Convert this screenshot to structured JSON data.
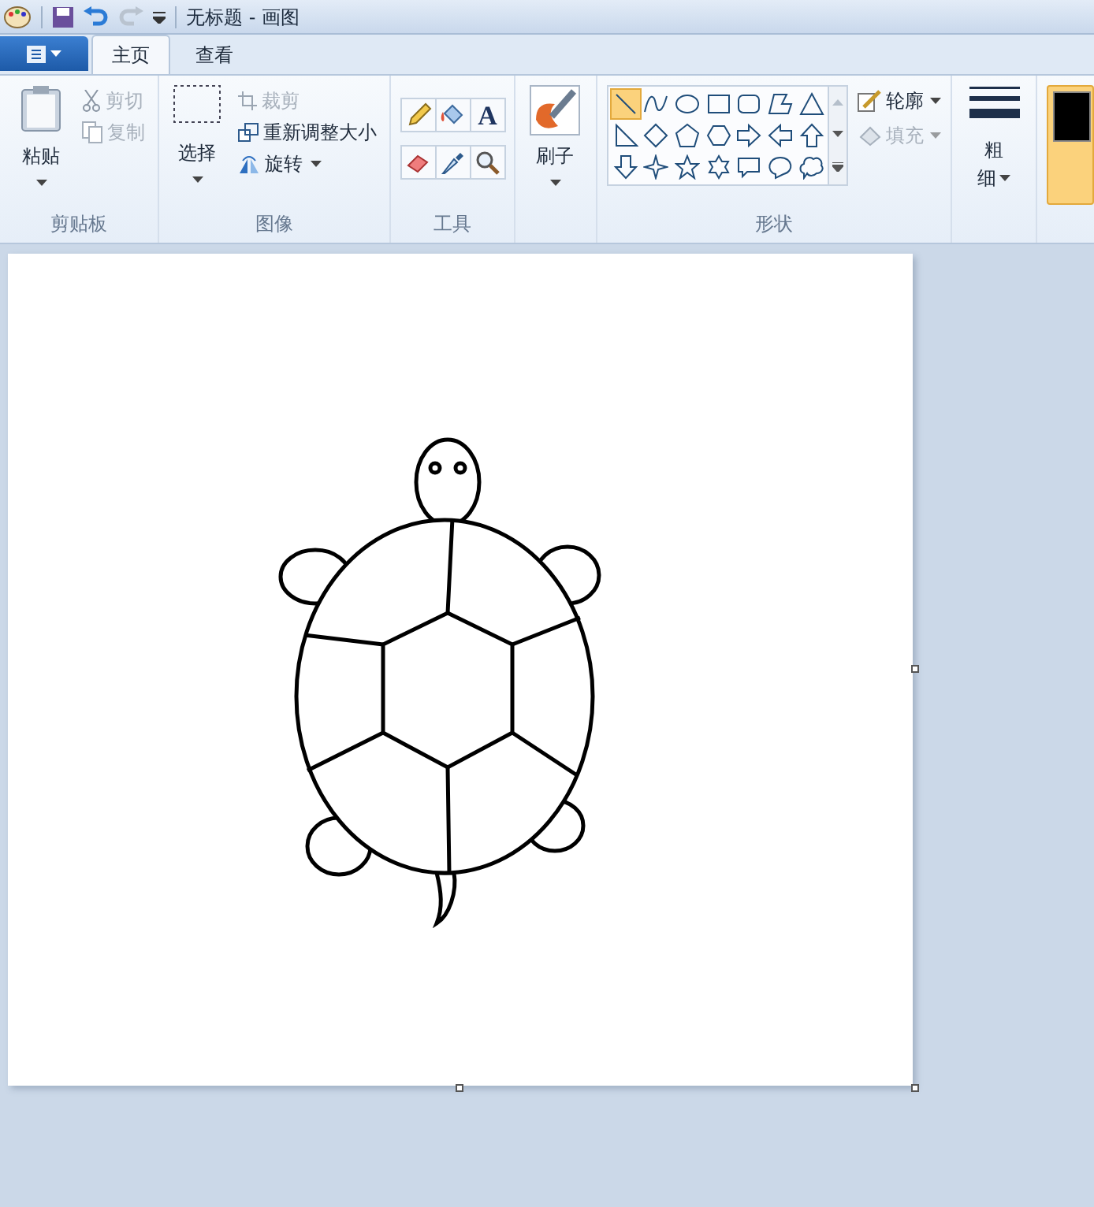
{
  "title_bar": {
    "title": "无标题 - 画图"
  },
  "tabs": [
    {
      "label": "主页",
      "selected": true
    },
    {
      "label": "查看",
      "selected": false
    }
  ],
  "ribbon": {
    "clipboard": {
      "paste": "粘贴",
      "cut": {
        "label": "剪切",
        "disabled": true
      },
      "copy": {
        "label": "复制",
        "disabled": true
      },
      "group_label": "剪贴板"
    },
    "image": {
      "select": "选择",
      "crop": {
        "label": "裁剪",
        "disabled": true
      },
      "resize": {
        "label": "重新调整大小",
        "disabled": false
      },
      "rotate": "旋转",
      "group_label": "图像"
    },
    "tools": {
      "items": [
        {
          "kind": "pencil"
        },
        {
          "kind": "fill"
        },
        {
          "kind": "text",
          "glyph": "A"
        },
        {
          "kind": "eraser"
        },
        {
          "kind": "picker"
        },
        {
          "kind": "magnifier"
        }
      ],
      "group_label": "工具"
    },
    "brushes": {
      "label": "刷子"
    },
    "shapes": {
      "items": [
        {
          "kind": "line",
          "selected": true
        },
        {
          "kind": "curve",
          "selected": false
        },
        {
          "kind": "oval",
          "selected": false
        },
        {
          "kind": "rectangle",
          "selected": false
        },
        {
          "kind": "rounded-rectangle",
          "selected": false
        },
        {
          "kind": "polygon",
          "selected": false
        },
        {
          "kind": "triangle",
          "selected": false
        },
        {
          "kind": "right-triangle",
          "selected": false
        },
        {
          "kind": "diamond",
          "selected": false
        },
        {
          "kind": "pentagon",
          "selected": false
        },
        {
          "kind": "hexagon",
          "selected": false
        },
        {
          "kind": "arrow-right",
          "selected": false
        },
        {
          "kind": "arrow-left",
          "selected": false
        },
        {
          "kind": "arrow-up",
          "selected": false
        },
        {
          "kind": "arrow-down",
          "selected": false
        },
        {
          "kind": "star-4",
          "selected": false
        },
        {
          "kind": "star-5",
          "selected": false
        },
        {
          "kind": "star-6",
          "selected": false
        },
        {
          "kind": "callout-rect",
          "selected": false
        },
        {
          "kind": "callout-oval",
          "selected": false
        },
        {
          "kind": "callout-cloud",
          "selected": false
        }
      ],
      "outline": {
        "label": "轮廓",
        "disabled": false
      },
      "fill": {
        "label": "填充",
        "disabled": true
      },
      "group_label": "形状"
    },
    "size": {
      "label_1": "粗",
      "label_2": "细"
    }
  }
}
